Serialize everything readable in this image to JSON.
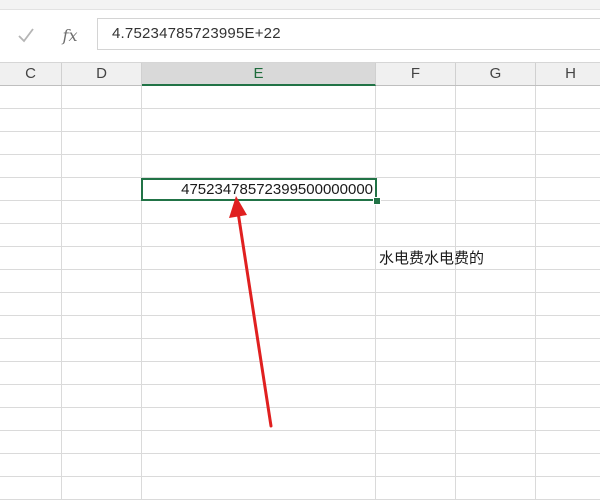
{
  "formula_bar": {
    "enter_icon": "checkmark-icon",
    "enter_glyph": "✓",
    "fx_label": "fx",
    "formula_value": "4.75234785723995E+22"
  },
  "columns": [
    {
      "letter": "C"
    },
    {
      "letter": "D"
    },
    {
      "letter": "E",
      "selected": true
    },
    {
      "letter": "F"
    },
    {
      "letter": "G"
    },
    {
      "letter": "H"
    }
  ],
  "cells": {
    "e_active_value": "47523478572399500000000",
    "f_text": "水电费水电费的"
  },
  "annotation": {
    "arrow_color": "#e02020",
    "arrow_icon": "red-arrow-icon"
  },
  "colors": {
    "selection_green": "#217346"
  }
}
